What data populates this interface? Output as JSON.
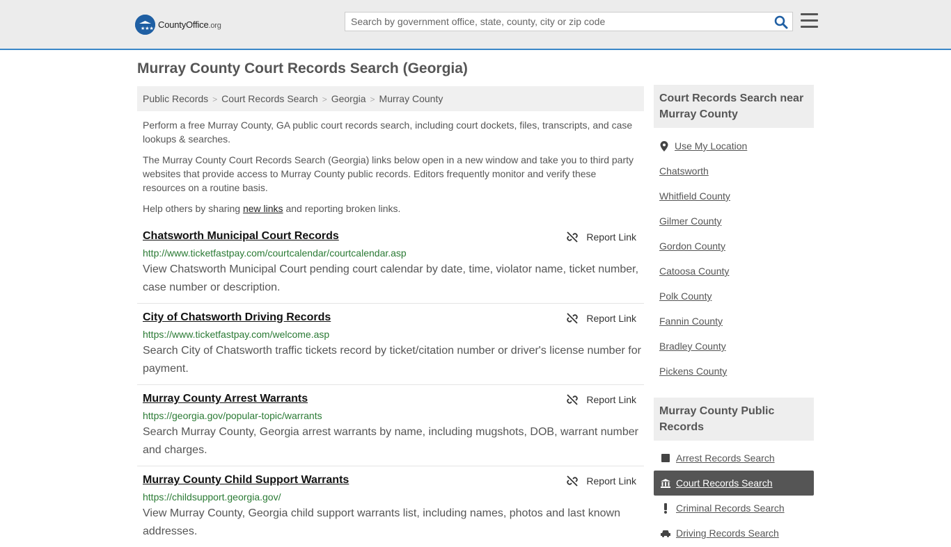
{
  "header": {
    "logo_name": "CountyOffice",
    "logo_tld": ".org",
    "search_placeholder": "Search by government office, state, county, city or zip code"
  },
  "page_title": "Murray County Court Records Search (Georgia)",
  "breadcrumb": [
    "Public Records",
    "Court Records Search",
    "Georgia",
    "Murray County"
  ],
  "intro": {
    "p1": "Perform a free Murray County, GA public court records search, including court dockets, files, transcripts, and case lookups & searches.",
    "p2": "The Murray County Court Records Search (Georgia) links below open in a new window and take you to third party websites that provide access to Murray County public records. Editors frequently monitor and verify these resources on a routine basis.",
    "p3_before": "Help others by sharing ",
    "p3_link": "new links",
    "p3_after": " and reporting broken links."
  },
  "report_label": "Report Link",
  "results": [
    {
      "title": "Chatsworth Municipal Court Records",
      "url": "http://www.ticketfastpay.com/courtcalendar/courtcalendar.asp",
      "desc": "View Chatsworth Municipal Court pending court calendar by date, time, violator name, ticket number, case number or description."
    },
    {
      "title": "City of Chatsworth Driving Records",
      "url": "https://www.ticketfastpay.com/welcome.asp",
      "desc": "Search City of Chatsworth traffic tickets record by ticket/citation number or driver's license number for payment."
    },
    {
      "title": "Murray County Arrest Warrants",
      "url": "https://georgia.gov/popular-topic/warrants",
      "desc": "Search Murray County, Georgia arrest warrants by name, including mugshots, DOB, warrant number and charges."
    },
    {
      "title": "Murray County Child Support Warrants",
      "url": "https://childsupport.georgia.gov/",
      "desc": "View Murray County, Georgia child support warrants list, including names, photos and last known addresses."
    }
  ],
  "sidebar": {
    "nearby_heading": "Court Records Search near Murray County",
    "use_location": "Use My Location",
    "nearby": [
      "Chatsworth",
      "Whitfield County",
      "Gilmer County",
      "Gordon County",
      "Catoosa County",
      "Polk County",
      "Fannin County",
      "Bradley County",
      "Pickens County"
    ],
    "public_heading": "Murray County Public Records",
    "public": [
      {
        "label": "Arrest Records Search",
        "icon": "square-icon",
        "active": false
      },
      {
        "label": "Court Records Search",
        "icon": "courthouse-icon",
        "active": true
      },
      {
        "label": "Criminal Records Search",
        "icon": "exclamation-icon",
        "active": false
      },
      {
        "label": "Driving Records Search",
        "icon": "car-icon",
        "active": false
      }
    ]
  },
  "colors": {
    "accent": "#3a87c8",
    "url_green": "#2a7a34",
    "logo_blue": "#1f5fa3"
  }
}
